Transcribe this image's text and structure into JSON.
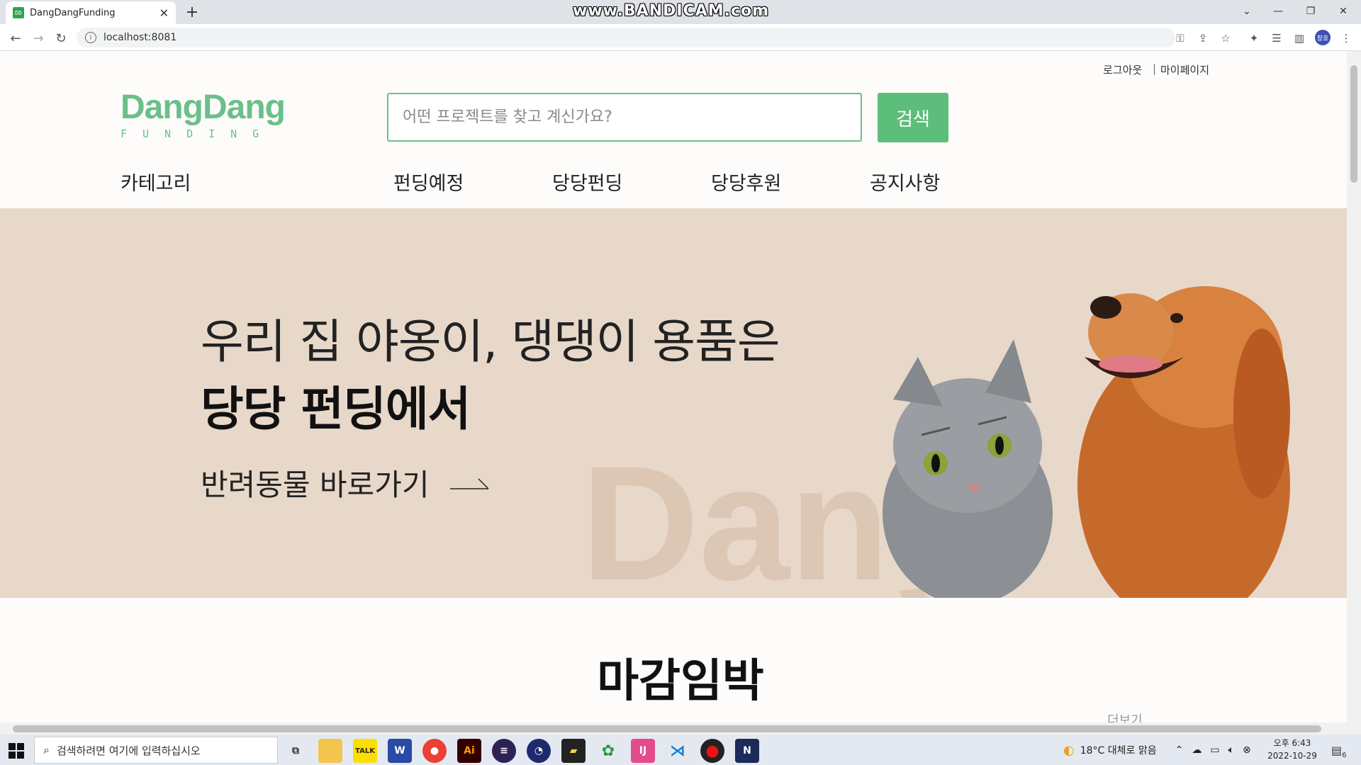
{
  "browser": {
    "tab_title": "DangDangFunding",
    "tab_favicon": "DD",
    "url": "localhost:8081",
    "watermark": "www.BANDICAM.com",
    "profile_initials": "창호"
  },
  "header": {
    "logout_label": "로그아웃",
    "separator": "|",
    "mypage_label": "마이페이지",
    "logo_main": "DangDang",
    "logo_sub": "FUNDING",
    "search_placeholder": "어떤 프로젝트를 찾고 계신가요?",
    "search_button": "검색"
  },
  "nav": {
    "category": "카테고리",
    "items": [
      "펀딩예정",
      "당당펀딩",
      "당당후원",
      "공지사항"
    ]
  },
  "hero": {
    "line1": "우리 집 야옹이, 댕댕이 용품은",
    "line2": "당당 펀딩에서",
    "link": "반려동물 바로가기",
    "bg_text": "Dang"
  },
  "section": {
    "title": "마감임박",
    "more": "더보기"
  },
  "taskbar": {
    "search_placeholder": "검색하려면 여기에 입력하십시오",
    "weather": "18°C  대체로 맑음",
    "time": "오후 6:43",
    "date": "2022-10-29",
    "notification_count": "6"
  },
  "colors": {
    "brand": "#6bbf8a",
    "button": "#5dbd7a",
    "hero_bg": "#e8d8ca"
  }
}
